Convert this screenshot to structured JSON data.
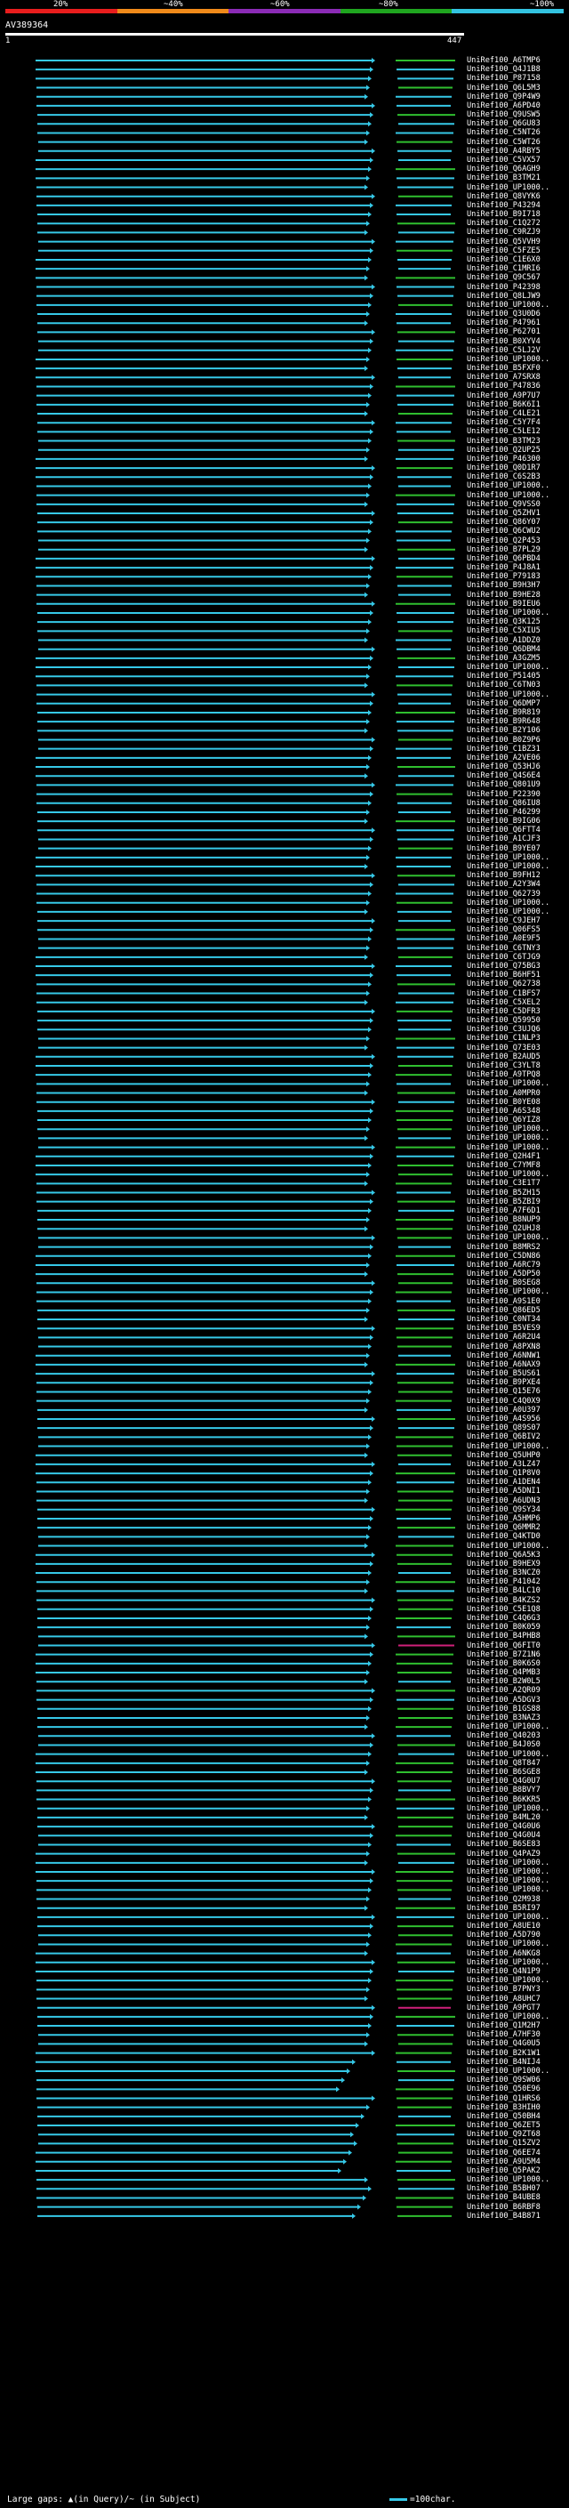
{
  "scale": {
    "ticks": [
      "20%",
      "~40%",
      "~60%",
      "~80%",
      "~100%"
    ],
    "colors": [
      "#e81d1d",
      "#f08a1a",
      "#8b2bb5",
      "#1fa51f",
      "#33c3e0"
    ]
  },
  "query": {
    "title": "AV389364",
    "start": "1",
    "end": "447"
  },
  "colors": {
    "cyan": "#36c9e8",
    "green": "#2fbf2f",
    "magenta": "#d0207a",
    "white": "#ffffff"
  },
  "hits": [
    "UniRef100_A6TMP6",
    "UniRef100_Q4J1B8",
    "UniRef100_P87158",
    "UniRef100_Q6L5M3",
    "UniRef100_Q9P4W9",
    "UniRef100_A6PD40",
    "UniRef100_Q9USW5",
    "UniRef100_Q6GU83",
    "UniRef100_C5NT26",
    "UniRef100_C5WT26",
    "UniRef100_A4RBY5",
    "UniRef100_C5VX57",
    "UniRef100_Q6AGH9",
    "UniRef100_B3TM21",
    "UniRef100_UP1000..",
    "UniRef100_Q8VYK6",
    "UniRef100_P43294",
    "UniRef100_B9I718",
    "UniRef100_C1Q272",
    "UniRef100_C9RZJ9",
    "UniRef100_Q5VVH9",
    "UniRef100_C5FZE5",
    "UniRef100_C1E6X0",
    "UniRef100_C1MRI6",
    "UniRef100_Q9C567",
    "UniRef100_P42398",
    "UniRef100_Q8LJW9",
    "UniRef100_UP1000..",
    "UniRef100_Q3U0D6",
    "UniRef100_P47961",
    "UniRef100_P62701",
    "UniRef100_B0XYV4",
    "UniRef100_C5LJ2V",
    "UniRef100_UP1000..",
    "UniRef100_B5FXF0",
    "UniRef100_A7SRX8",
    "UniRef100_P47836",
    "UniRef100_A9P7U7",
    "UniRef100_B6K6I1",
    "UniRef100_C4LE21",
    "UniRef100_C5Y7F4",
    "UniRef100_C5LE12",
    "UniRef100_B3TM23",
    "UniRef100_Q2UP25",
    "UniRef100_P46300",
    "UniRef100_Q0D1R7",
    "UniRef100_C6S2B3",
    "UniRef100_UP1000..",
    "UniRef100_UP1000..",
    "UniRef100_Q9VSS0",
    "UniRef100_Q5ZHV1",
    "UniRef100_Q86Y07",
    "UniRef100_Q6CWU2",
    "UniRef100_Q2P453",
    "UniRef100_B7PL29",
    "UniRef100_Q6PBD4",
    "UniRef100_P4J8A1",
    "UniRef100_P79183",
    "UniRef100_B9H3H7",
    "UniRef100_B9HE28",
    "UniRef100_B9IEU6",
    "UniRef100_UP1000..",
    "UniRef100_Q3K125",
    "UniRef100_C5XIU5",
    "UniRef100_A1DDZ0",
    "UniRef100_Q6DBM4",
    "UniRef100_A3GZM5",
    "UniRef100_UP1000..",
    "UniRef100_P51405",
    "UniRef100_C6TN03",
    "UniRef100_UP1000..",
    "UniRef100_Q6DMP7",
    "UniRef100_B9R819",
    "UniRef100_B9R648",
    "UniRef100_B2Y106",
    "UniRef100_B0Z9P6",
    "UniRef100_C1BZ31",
    "UniRef100_A2VE06",
    "UniRef100_Q53HJ6",
    "UniRef100_Q4S6E4",
    "UniRef100_Q801U9",
    "UniRef100_P22390",
    "UniRef100_Q86IU8",
    "UniRef100_P46299",
    "UniRef100_B9IG06",
    "UniRef100_Q6FTT4",
    "UniRef100_A1CJF3",
    "UniRef100_B9YE07",
    "UniRef100_UP1000..",
    "UniRef100_UP1000..",
    "UniRef100_B9FH12",
    "UniRef100_A2Y3W4",
    "UniRef100_Q62739",
    "UniRef100_UP1000..",
    "UniRef100_UP1000..",
    "UniRef100_C9JEH7",
    "UniRef100_Q06FS5",
    "UniRef100_A0E9F5",
    "UniRef100_C6TNY3",
    "UniRef100_C6TJG9",
    "UniRef100_Q75BG3",
    "UniRef100_B6HF51",
    "UniRef100_Q62738",
    "UniRef100_C1BFS7",
    "UniRef100_C5XEL2",
    "UniRef100_C5DFR3",
    "UniRef100_Q59950",
    "UniRef100_C3UJQ6",
    "UniRef100_C1NLP3",
    "UniRef100_Q73E03",
    "UniRef100_B2AUD5",
    "UniRef100_C3YLT8",
    "UniRef100_A9TPQ8",
    "UniRef100_UP1000..",
    "UniRef100_A0MPR0",
    "UniRef100_B0YE08",
    "UniRef100_A6S348",
    "UniRef100_Q6YIZ8",
    "UniRef100_UP1000..",
    "UniRef100_UP1000..",
    "UniRef100_UP1000..",
    "UniRef100_Q2H4F1",
    "UniRef100_C7YMF8",
    "UniRef100_UP1000..",
    "UniRef100_C3E1T7",
    "UniRef100_B5ZH15",
    "UniRef100_B5ZBI9",
    "UniRef100_A7F6D1",
    "UniRef100_B8NUP9",
    "UniRef100_Q2UHJ8",
    "UniRef100_UP1000..",
    "UniRef100_B8MRS2",
    "UniRef100_C5DN86",
    "UniRef100_A6RC79",
    "UniRef100_A5DP50",
    "UniRef100_B0SEG8",
    "UniRef100_UP1000..",
    "UniRef100_A9S1E0",
    "UniRef100_Q86ED5",
    "UniRef100_C0NT34",
    "UniRef100_B5VES9",
    "UniRef100_A6R2U4",
    "UniRef100_A8PXN8",
    "UniRef100_A6NNW1",
    "UniRef100_A6NAX9",
    "UniRef100_B5US61",
    "UniRef100_B9PXE4",
    "UniRef100_Q15E76",
    "UniRef100_C4Q0X9",
    "UniRef100_A0U397",
    "UniRef100_A4S956",
    "UniRef100_Q89S07",
    "UniRef100_Q6BIV2",
    "UniRef100_UP1000..",
    "UniRef100_Q5UHP0",
    "UniRef100_A3LZ47",
    "UniRef100_Q1P8V0",
    "UniRef100_A1DEN4",
    "UniRef100_A5DNI1",
    "UniRef100_A6UDN3",
    "UniRef100_Q9SY34",
    "UniRef100_A5HMP6",
    "UniRef100_Q6MMR2",
    "UniRef100_Q4KTD0",
    "UniRef100_UP1000..",
    "UniRef100_Q6A5K3",
    "UniRef100_B9HEX9",
    "UniRef100_B3NCZ0",
    "UniRef100_P41042",
    "UniRef100_B4LC10",
    "UniRef100_B4KZS2",
    "UniRef100_C5E1Q8",
    "UniRef100_C4Q6G3",
    "UniRef100_B0K059",
    "UniRef100_B4PHB8",
    "UniRef100_Q6FIT0",
    "UniRef100_B7Z1N6",
    "UniRef100_B0K6S0",
    "UniRef100_Q4PMB3",
    "UniRef100_B2W0L5",
    "UniRef100_A2QR09",
    "UniRef100_A5DGV3",
    "UniRef100_B1GS88",
    "UniRef100_B3NAZ3",
    "UniRef100_UP1000..",
    "UniRef100_Q40203",
    "UniRef100_B4J0S0",
    "UniRef100_UP1000..",
    "UniRef100_Q8T847",
    "UniRef100_B6SGE8",
    "UniRef100_Q4G0U7",
    "UniRef100_B8BVY7",
    "UniRef100_B6KKR5",
    "UniRef100_UP1000..",
    "UniRef100_B4ML20",
    "UniRef100_Q4G0U6",
    "UniRef100_Q4G0U4",
    "UniRef100_B6SE83",
    "UniRef100_Q4PAZ9",
    "UniRef100_UP1000..",
    "UniRef100_UP1000..",
    "UniRef100_UP1000..",
    "UniRef100_UP1000..",
    "UniRef100_Q2M938",
    "UniRef100_B5RI97",
    "UniRef100_UP1000..",
    "UniRef100_A8UE10",
    "UniRef100_A5D790",
    "UniRef100_UP1000..",
    "UniRef100_A6NKG8",
    "UniRef100_UP1000..",
    "UniRef100_Q4N1P9",
    "UniRef100_UP1000..",
    "UniRef100_B7PNY3",
    "UniRef100_A8UHC7",
    "UniRef100_A9PGT7",
    "UniRef100_UP1000..",
    "UniRef100_Q1M2H7",
    "UniRef100_A7HF30",
    "UniRef100_Q4G0U5",
    "UniRef100_B2K1W1",
    "UniRef100_B4NIJ4",
    "UniRef100_UP1000..",
    "UniRef100_Q9SW06",
    "UniRef100_Q50E96",
    "UniRef100_Q1HRS6",
    "UniRef100_B3HIH0",
    "UniRef100_Q50BH4",
    "UniRef100_Q6ZET5",
    "UniRef100_Q9ZT68",
    "UniRef100_Q15ZV2",
    "UniRef100_Q6EE74",
    "UniRef100_A9U5M4",
    "UniRef100_Q5PAK2",
    "UniRef100_UP1000..",
    "UniRef100_B5BH07",
    "UniRef100_B4UBE8",
    "UniRef100_B6RBF8",
    "UniRef100_B4B871"
  ],
  "footer": {
    "gaps_text": "Large gaps: ▲(in Query)/~ (in Subject)",
    "legend_text": "=100char."
  }
}
